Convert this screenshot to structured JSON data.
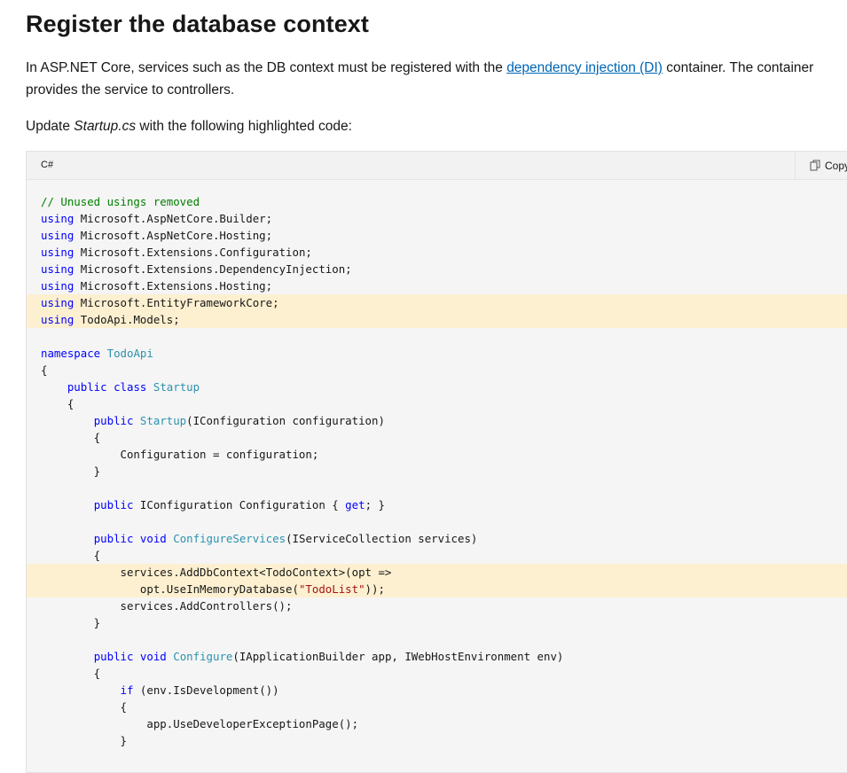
{
  "heading": "Register the database context",
  "intro": {
    "before_link": "In ASP.NET Core, services such as the DB context must be registered with the ",
    "link_text": "dependency injection (DI)",
    "after_link": " container. The container provides the service to controllers."
  },
  "update_line": {
    "before": "Update ",
    "file": "Startup.cs",
    "after": " with the following highlighted code:"
  },
  "code": {
    "language": "C#",
    "copy_label": "Copy",
    "lines": [
      [
        {
          "t": "// Unused usings removed",
          "c": "cm"
        }
      ],
      [
        {
          "t": "using",
          "c": "kw"
        },
        {
          "t": " Microsoft.AspNetCore.Builder;"
        }
      ],
      [
        {
          "t": "using",
          "c": "kw"
        },
        {
          "t": " Microsoft.AspNetCore.Hosting;"
        }
      ],
      [
        {
          "t": "using",
          "c": "kw"
        },
        {
          "t": " Microsoft.Extensions.Configuration;"
        }
      ],
      [
        {
          "t": "using",
          "c": "kw"
        },
        {
          "t": " Microsoft.Extensions.DependencyInjection;"
        }
      ],
      [
        {
          "t": "using",
          "c": "kw"
        },
        {
          "t": " Microsoft.Extensions.Hosting;"
        }
      ],
      {
        "hl": true,
        "parts": [
          {
            "t": "using",
            "c": "kw"
          },
          {
            "t": " Microsoft.EntityFrameworkCore;"
          }
        ]
      },
      {
        "hl": true,
        "parts": [
          {
            "t": "using",
            "c": "kw"
          },
          {
            "t": " TodoApi.Models;"
          }
        ]
      },
      [],
      [
        {
          "t": "namespace",
          "c": "kw"
        },
        {
          "t": " "
        },
        {
          "t": "TodoApi",
          "c": "ty"
        }
      ],
      [
        {
          "t": "{"
        }
      ],
      [
        {
          "t": "    "
        },
        {
          "t": "public",
          "c": "kw"
        },
        {
          "t": " "
        },
        {
          "t": "class",
          "c": "kw"
        },
        {
          "t": " "
        },
        {
          "t": "Startup",
          "c": "ty"
        }
      ],
      [
        {
          "t": "    {"
        }
      ],
      [
        {
          "t": "        "
        },
        {
          "t": "public",
          "c": "kw"
        },
        {
          "t": " "
        },
        {
          "t": "Startup",
          "c": "ty"
        },
        {
          "t": "(IConfiguration configuration)"
        }
      ],
      [
        {
          "t": "        {"
        }
      ],
      [
        {
          "t": "            Configuration = configuration;"
        }
      ],
      [
        {
          "t": "        }"
        }
      ],
      [],
      [
        {
          "t": "        "
        },
        {
          "t": "public",
          "c": "kw"
        },
        {
          "t": " IConfiguration Configuration { "
        },
        {
          "t": "get",
          "c": "kw"
        },
        {
          "t": "; }"
        }
      ],
      [],
      [
        {
          "t": "        "
        },
        {
          "t": "public",
          "c": "kw"
        },
        {
          "t": " "
        },
        {
          "t": "void",
          "c": "kw"
        },
        {
          "t": " "
        },
        {
          "t": "ConfigureServices",
          "c": "ty"
        },
        {
          "t": "(IServiceCollection services)"
        }
      ],
      [
        {
          "t": "        {"
        }
      ],
      {
        "hl": true,
        "parts": [
          {
            "t": "            services.AddDbContext<TodoContext>(opt =>"
          }
        ]
      },
      {
        "hl": true,
        "parts": [
          {
            "t": "               opt.UseInMemoryDatabase("
          },
          {
            "t": "\"TodoList\"",
            "c": "st"
          },
          {
            "t": "));"
          }
        ]
      },
      [
        {
          "t": "            services.AddControllers();"
        }
      ],
      [
        {
          "t": "        }"
        }
      ],
      [],
      [
        {
          "t": "        "
        },
        {
          "t": "public",
          "c": "kw"
        },
        {
          "t": " "
        },
        {
          "t": "void",
          "c": "kw"
        },
        {
          "t": " "
        },
        {
          "t": "Configure",
          "c": "ty"
        },
        {
          "t": "(IApplicationBuilder app, IWebHostEnvironment env)"
        }
      ],
      [
        {
          "t": "        {"
        }
      ],
      [
        {
          "t": "            "
        },
        {
          "t": "if",
          "c": "kw"
        },
        {
          "t": " (env.IsDevelopment())"
        }
      ],
      [
        {
          "t": "            {"
        }
      ],
      [
        {
          "t": "                app.UseDeveloperExceptionPage();"
        }
      ],
      [
        {
          "t": "            }"
        }
      ]
    ]
  },
  "colors": {
    "keyword": "#0101fd",
    "type": "#2b91af",
    "comment": "#008000",
    "string": "#a31515",
    "highlight": "#fdf0d1",
    "link": "#0065b3"
  },
  "icons": {
    "copy": "copy-icon"
  }
}
